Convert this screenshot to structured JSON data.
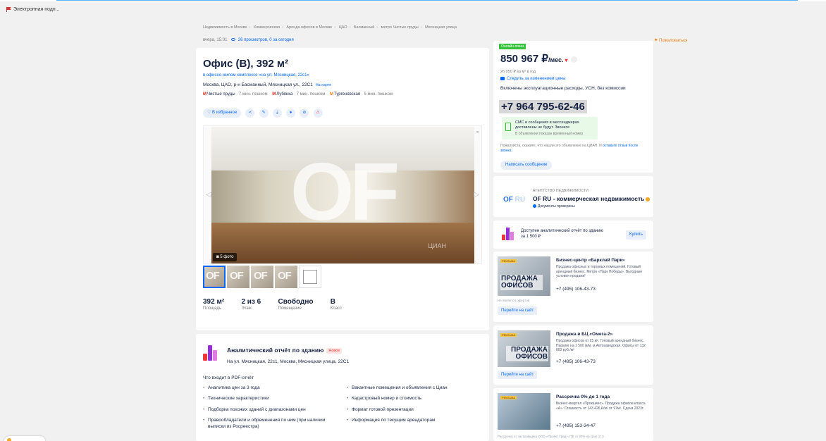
{
  "browser": {
    "bookmark": "Электронная подп..."
  },
  "breadcrumbs": [
    "Недвижимость в Москве",
    "Коммерческая",
    "Аренда офисов в Москве",
    "ЦАО",
    "Басманный",
    "метро Чистые пруды",
    "Мясницкая улица"
  ],
  "meta": {
    "time": "вчера, 15:01",
    "views": "26 просмотров, 0 за сегодня",
    "complaint": "Пожаловаться"
  },
  "listing": {
    "title": "Офис (B), 392 м²",
    "complex_link": "в офисно-жилом комплексе «на ул. Мясницкая, 22с1»",
    "address": "Москва, ЦАО, р-н Басманный, Мясницкая ул., 22С1",
    "map_link": "На карте",
    "metro": [
      {
        "name": "Чистые пруды",
        "time": "· 7 мин. пешком",
        "color": "#e42313"
      },
      {
        "name": "Лубянка",
        "time": "· 7 мин. пешком",
        "color": "#e42313"
      },
      {
        "name": "Тургеневская",
        "time": "· 5 мин. пешком",
        "color": "#f58220"
      }
    ],
    "favorite": "В избранное",
    "photo_watermark": "OF",
    "photo_source": "ЦИАН",
    "photo_count": "5 фото",
    "facts": [
      {
        "value": "392 м²",
        "label": "Площадь"
      },
      {
        "value": "2 из 6",
        "label": "Этаж"
      },
      {
        "value": "Свободно",
        "label": "Помещение"
      },
      {
        "value": "B",
        "label": "Класс"
      }
    ]
  },
  "report": {
    "title": "Аналитический отчёт по зданию",
    "badge": "Новое",
    "address": "На ул. Мясницкая, 22с1, Москва, Мясницкая улица, 22С1",
    "what": "Что входит в PDF-отчёт",
    "col1": [
      "Аналитика цен за 3 года",
      "Технические характеристики",
      "Подборка похожих зданий с диапазонами цен",
      "Правообладатели и обременения по ним (при наличии выписки из Росреестра)"
    ],
    "col2": [
      "Вакантные помещения и объявления с Циан",
      "Кадастровый номер и стоимость",
      "Формат готовой презентации",
      "Информация по текущим арендаторам"
    ]
  },
  "price": {
    "online_badge": "Онлайн-показ",
    "amount": "850 967 ₽",
    "period": "/мес.",
    "per_sqm": "26 050 ₽ за м² в год",
    "follow": "Следить за изменением цены",
    "terms": "Включены эксплуатационные расходы, УСН, без комиссии",
    "phone": "+7 964 795-62-46",
    "sms_title": "СМС и сообщения в мессенджерах доставлены не будут. Звоните",
    "sms_note": "В объявлении показан временный номер",
    "note_text": "Пожалуйста, скажите, что нашли это объявление на ЦИАН. И",
    "note_link": "оставьте отзыв после звонка",
    "write": "Написать сообщение"
  },
  "agency": {
    "logo": "OF",
    "logo_suffix": "RU",
    "caption": "АГЕНТСТВО НЕДВИЖИМОСТИ",
    "name": "OF RU - коммерческая недвижимость",
    "verified": "Документы проверены"
  },
  "analytic": {
    "text": "Доступен аналитический отчёт по зданию за 1 500 ₽",
    "buy": "Купить"
  },
  "ads": [
    {
      "tag": "РЕКЛАМА",
      "image_text": "ПРОДАЖА ОФИСОВ",
      "title": "Бизнес-центр «Барклай Парк»",
      "desc": "Продажа офисных и торговых помещений. Готовый арендный бизнес. Метро «Парк Победы». Выгодные условия продажи!",
      "phone": "+7 (495) 106-43-73",
      "legal": "Не является офертой",
      "go": "Перейти на сайт"
    },
    {
      "tag": "РЕКЛАМА",
      "image_text": "ПРОДАЖА ОФИСОВ",
      "title": "Продажа в БЦ «Омега-2»",
      "desc": "Продажа офисов от 25 м². Готовый арендный бизнес. Паркинг на 1 500 м/м. м.Автозаводская. Офисы от 132 000 руб./м²",
      "phone": "+7 (495) 106-43-73",
      "go": "Перейти на сайт"
    },
    {
      "tag": "РЕКЛАМА",
      "title": "Рассрочка 0% до 1 года",
      "desc": "Бизнес-квартал «Прокшино». Продажа офисов класса «А». Стоимость от 143 426 ₽/м² от 97м². Сдача 2023г.",
      "phone": "+7 (495) 153-34-47",
      "legal": "Рассрочка от застройщика ООО «Проект Град». ПВ от 30% на срок от 3"
    }
  ]
}
